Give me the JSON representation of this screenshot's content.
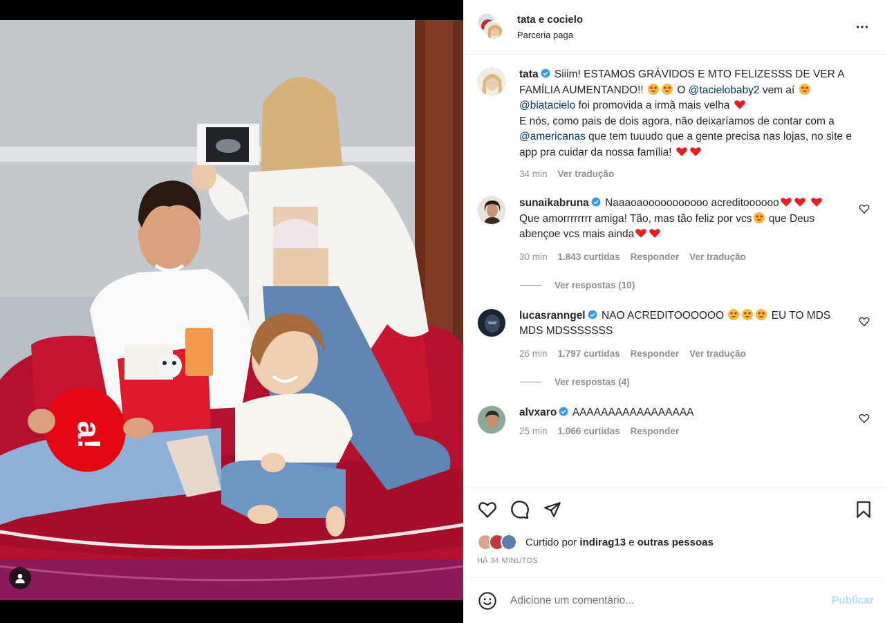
{
  "header": {
    "username": "tata e cocielo",
    "subtitle": "Parceria paga"
  },
  "caption": {
    "user": "tata",
    "text_1": "Siiim! ESTAMOS GRÁVIDOS E MTO FELIZESSS DE VER A FAMÍLIA AUMENTANDO!!",
    "text_2": "O",
    "mention_1": "@tacielobaby2",
    "text_3": "vem aí",
    "mention_2": "@biatacielo",
    "text_4": "foi promovida a irmã mais velha",
    "text_5": "E nós, como pais de dois agora, não deixaríamos de contar com a",
    "mention_3": "@americanas",
    "text_6": "que tem tuuudo que a gente precisa nas lojas, no site e app pra cuidar da nossa família!",
    "time": "34 min",
    "translate": "Ver tradução"
  },
  "comments": [
    {
      "user": "sunaikabruna",
      "text_a": "Naaaoaooooooooooo acreditoooooo",
      "text_b": "Que amorrrrrrrr amiga! Tão, mas tão feliz por vcs",
      "text_c": "que Deus abençoe vcs mais ainda",
      "time": "30 min",
      "likes": "1.843 curtidas",
      "reply": "Responder",
      "translate": "Ver tradução",
      "view_replies": "Ver respostas (10)"
    },
    {
      "user": "lucasranngel",
      "text_a": "NAO ACREDITOOOOOO",
      "text_b": "EU TO MDS MDS MDSSSSSSS",
      "time": "26 min",
      "likes": "1.797 curtidas",
      "reply": "Responder",
      "translate": "Ver tradução",
      "view_replies": "Ver respostas (4)"
    },
    {
      "user": "alvxaro",
      "text_a": "AAAAAAAAAAAAAAAAA",
      "time": "25 min",
      "likes": "1.066 curtidas",
      "reply": "Responder"
    }
  ],
  "likes": {
    "prefix": "Curtido por",
    "user": "indirag13",
    "middle": "e",
    "others": "outras pessoas"
  },
  "timestamp": "HÁ 34 MINUTOS",
  "add_comment": {
    "placeholder": "Adicione um comentário...",
    "publish": "Publicar"
  },
  "photo": {
    "box_logo": "a!"
  },
  "colors": {
    "link": "#00376b",
    "verified": "#3897f0",
    "heart": "#ed1c24",
    "publish_disabled": "#b2dffc",
    "americanas_red": "#e30613"
  }
}
